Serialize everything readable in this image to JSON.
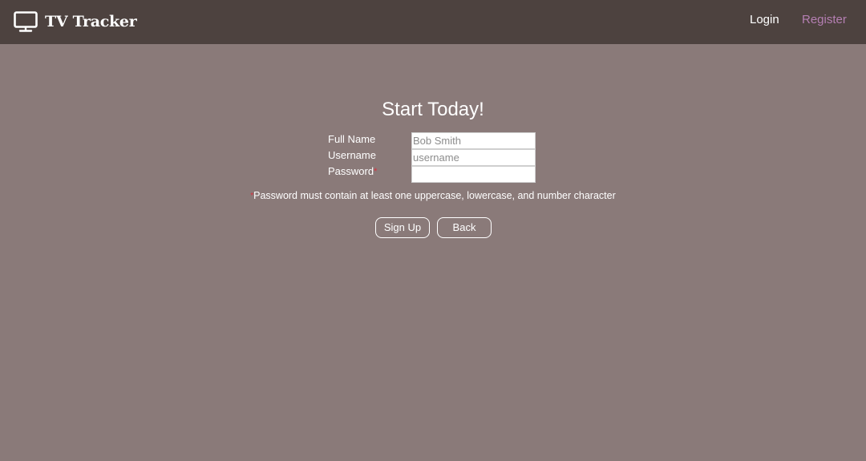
{
  "navbar": {
    "brand_icon": "tv-monitor-icon",
    "brand_text": "TV Tracker",
    "login_label": "Login",
    "register_label": "Register",
    "register_color": "#b57fb3",
    "background": "#4d423f"
  },
  "page": {
    "background": "#8a7a79",
    "title": "Start Today!"
  },
  "form": {
    "full_name_label": "Full Name",
    "full_name_placeholder": "Bob Smith",
    "full_name_value": "",
    "username_label": "Username",
    "username_placeholder": "username",
    "username_value": "",
    "password_label": "Password",
    "password_required_mark": "*",
    "password_value": "",
    "note_required_mark": "*",
    "password_note": "Password must contain at least one uppercase, lowercase, and number character",
    "required_color": "#d9303e"
  },
  "buttons": {
    "signup_label": "Sign Up",
    "back_label": "Back"
  }
}
